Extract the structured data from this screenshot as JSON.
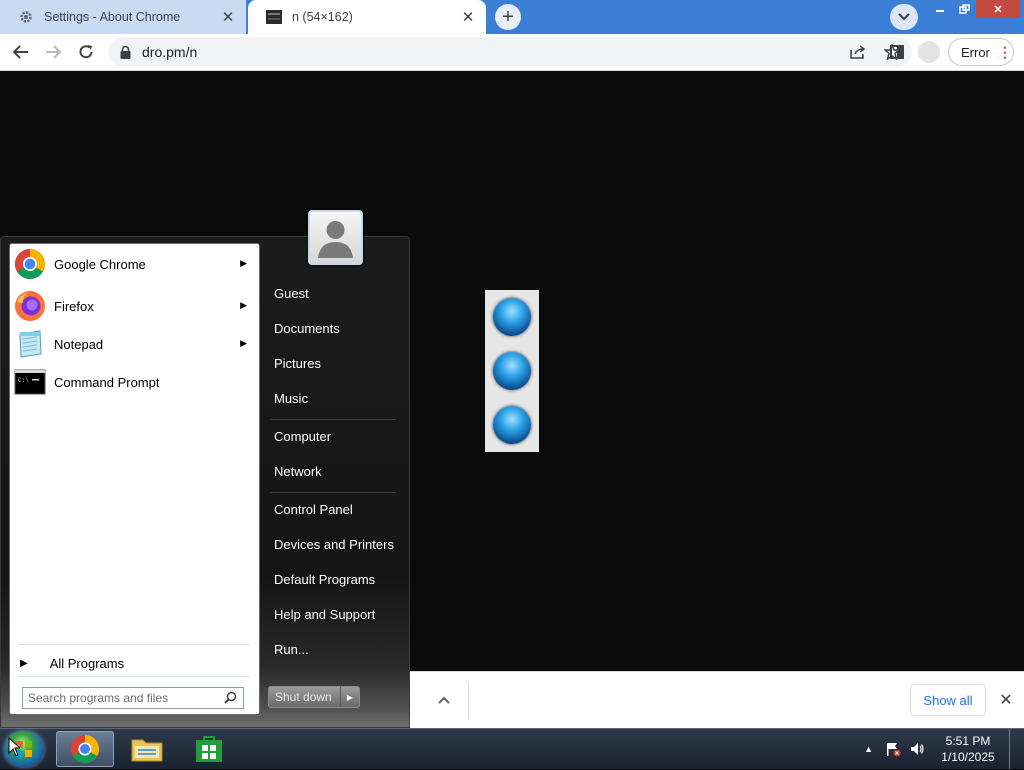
{
  "browser": {
    "tabs": [
      {
        "title": "Settings - About Chrome",
        "active": false
      },
      {
        "title": "n (54×162)",
        "active": true
      }
    ],
    "url": "dro.pm/n",
    "error_label": "Error",
    "colors": {
      "frame": "#3b7ed6",
      "toolbar": "#ffffff",
      "error_dots": "#d93025"
    }
  },
  "start_menu": {
    "programs": [
      {
        "label": "Google Chrome",
        "has_submenu": true,
        "icon": "chrome-icon"
      },
      {
        "label": "Firefox",
        "has_submenu": true,
        "icon": "firefox-icon"
      },
      {
        "label": "Notepad",
        "has_submenu": true,
        "icon": "notepad-icon"
      },
      {
        "label": "Command Prompt",
        "has_submenu": false,
        "icon": "cmd-icon"
      }
    ],
    "all_programs": "All Programs",
    "search_placeholder": "Search programs and files",
    "right_links": {
      "user": "Guest",
      "documents": "Documents",
      "pictures": "Pictures",
      "music": "Music",
      "computer": "Computer",
      "network": "Network",
      "control_panel": "Control Panel",
      "devices": "Devices and Printers",
      "default_programs": "Default Programs",
      "help": "Help and Support",
      "run": "Run..."
    },
    "shutdown": "Shut down"
  },
  "download_bar": {
    "show_all": "Show all"
  },
  "taskbar": {
    "apps": [
      "chrome-icon",
      "explorer-icon",
      "store-icon"
    ],
    "clock": {
      "time": "5:51 PM",
      "date": "1/10/2025"
    }
  }
}
